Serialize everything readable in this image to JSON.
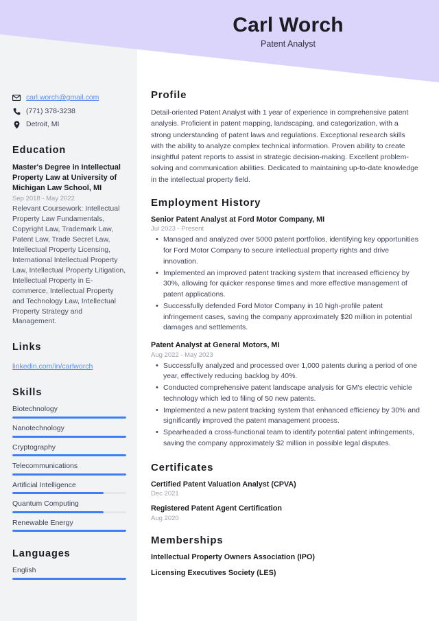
{
  "header": {
    "name": "Carl Worch",
    "title": "Patent Analyst",
    "banner_color": "#dcd5fb"
  },
  "sidebar": {
    "background_color": "#f2f3f5",
    "contact": [
      {
        "icon": "envelope-icon",
        "text": "carl.worch@gmail.com",
        "is_link": true
      },
      {
        "icon": "phone-icon",
        "text": "(771) 378-3238",
        "is_link": false
      },
      {
        "icon": "location-pin-icon",
        "text": "Detroit, MI",
        "is_link": false
      }
    ],
    "education": {
      "heading": "Education",
      "degree": "Master's Degree in Intellectual Property Law at University of Michigan Law School, MI",
      "date": "Sep 2018 - May 2022",
      "description": "Relevant Coursework: Intellectual Property Law Fundamentals, Copyright Law, Trademark Law, Patent Law, Trade Secret Law, Intellectual Property Licensing, International Intellectual Property Law, Intellectual Property Litigation, Intellectual Property in E-commerce, Intellectual Property and Technology Law, Intellectual Property Strategy and Management."
    },
    "links": {
      "heading": "Links",
      "items": [
        {
          "label": "linkedin.com/in/carlworch"
        }
      ]
    },
    "skills": {
      "heading": "Skills",
      "bar_color": "#3d7df5",
      "track_color": "#e6e7ea",
      "items": [
        {
          "label": "Biotechnology",
          "level": 100
        },
        {
          "label": "Nanotechnology",
          "level": 100
        },
        {
          "label": "Cryptography",
          "level": 100
        },
        {
          "label": "Telecommunications",
          "level": 100
        },
        {
          "label": "Artificial Intelligence",
          "level": 80
        },
        {
          "label": "Quantum Computing",
          "level": 80
        },
        {
          "label": "Renewable Energy",
          "level": 100
        }
      ]
    },
    "languages": {
      "heading": "Languages",
      "items": [
        {
          "label": "English",
          "level": 100
        }
      ]
    }
  },
  "main": {
    "profile": {
      "heading": "Profile",
      "text": "Detail-oriented Patent Analyst with 1 year of experience in comprehensive patent analysis. Proficient in patent mapping, landscaping, and categorization, with a strong understanding of patent laws and regulations. Exceptional research skills with the ability to analyze complex technical information. Proven ability to create insightful patent reports to assist in strategic decision-making. Excellent problem-solving and communication abilities. Dedicated to maintaining up-to-date knowledge in the intellectual property field."
    },
    "employment": {
      "heading": "Employment History",
      "jobs": [
        {
          "title": "Senior Patent Analyst at Ford Motor Company, MI",
          "date": "Jul 2023 - Present",
          "bullets": [
            "Managed and analyzed over 5000 patent portfolios, identifying key opportunities for Ford Motor Company to secure intellectual property rights and drive innovation.",
            "Implemented an improved patent tracking system that increased efficiency by 30%, allowing for quicker response times and more effective management of patent applications.",
            "Successfully defended Ford Motor Company in 10 high-profile patent infringement cases, saving the company approximately $20 million in potential damages and settlements."
          ]
        },
        {
          "title": "Patent Analyst at General Motors, MI",
          "date": "Aug 2022 - May 2023",
          "bullets": [
            "Successfully analyzed and processed over 1,000 patents during a period of one year, effectively reducing backlog by 40%.",
            "Conducted comprehensive patent landscape analysis for GM's electric vehicle technology which led to filing of 50 new patents.",
            "Implemented a new patent tracking system that enhanced efficiency by 30% and significantly improved the patent management process.",
            "Spearheaded a cross-functional team to identify potential patent infringements, saving the company approximately $2 million in possible legal disputes."
          ]
        }
      ]
    },
    "certificates": {
      "heading": "Certificates",
      "items": [
        {
          "name": "Certified Patent Valuation Analyst (CPVA)",
          "date": "Dec 2021"
        },
        {
          "name": "Registered Patent Agent Certification",
          "date": "Aug 2020"
        }
      ]
    },
    "memberships": {
      "heading": "Memberships",
      "items": [
        {
          "name": "Intellectual Property Owners Association (IPO)"
        },
        {
          "name": "Licensing Executives Society (LES)"
        }
      ]
    }
  }
}
